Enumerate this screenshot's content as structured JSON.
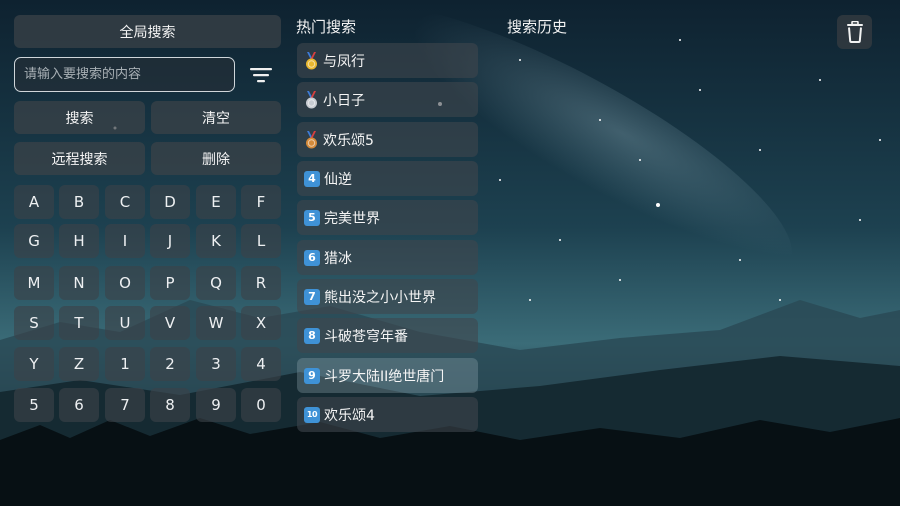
{
  "search": {
    "global_search_label": "全局搜索",
    "placeholder": "请输入要搜索的内容",
    "value": "",
    "search_button": "搜索",
    "clear_button": "清空",
    "remote_search_button": "远程搜索",
    "delete_button": "删除"
  },
  "keyboard": {
    "keys": [
      "A",
      "B",
      "C",
      "D",
      "E",
      "F",
      "G",
      "H",
      "I",
      "J",
      "K",
      "L",
      "M",
      "N",
      "O",
      "P",
      "Q",
      "R",
      "S",
      "T",
      "U",
      "V",
      "W",
      "X",
      "Y",
      "Z",
      "1",
      "2",
      "3",
      "4",
      "5",
      "6",
      "7",
      "8",
      "9",
      "0"
    ]
  },
  "hot": {
    "title": "热门搜索",
    "items": [
      {
        "rank": "1",
        "label": "与凤行",
        "medal": "gold"
      },
      {
        "rank": "2",
        "label": "小日子",
        "medal": "silver"
      },
      {
        "rank": "3",
        "label": "欢乐颂5",
        "medal": "bronze"
      },
      {
        "rank": "4",
        "label": "仙逆"
      },
      {
        "rank": "5",
        "label": "完美世界"
      },
      {
        "rank": "6",
        "label": "猎冰"
      },
      {
        "rank": "7",
        "label": "熊出没之小小世界"
      },
      {
        "rank": "8",
        "label": "斗破苍穹年番"
      },
      {
        "rank": "9",
        "label": "斗罗大陆II绝世唐门"
      },
      {
        "rank": "10",
        "label": "欢乐颂4"
      }
    ]
  },
  "history": {
    "title": "搜索历史"
  },
  "icons": {
    "filter": "filter-icon",
    "trash": "trash-icon",
    "medal_gold": "gold-medal-icon",
    "medal_silver": "silver-medal-icon",
    "medal_bronze": "bronze-medal-icon"
  },
  "colors": {
    "medal_gold": "#e8b730",
    "medal_silver": "#c8ccd2",
    "medal_bronze": "#d48a3a",
    "rank_box": "#3f92d6"
  }
}
